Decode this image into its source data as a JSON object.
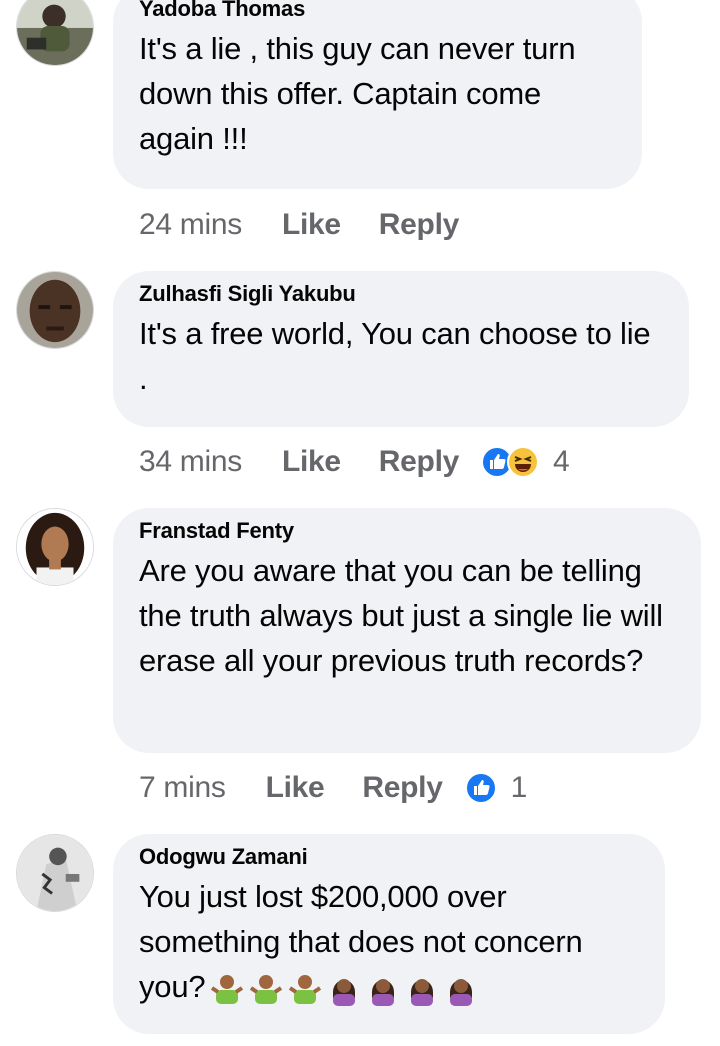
{
  "colors": {
    "bubble_bg": "#f0f2f5",
    "author": "#050505",
    "meta_text": "#65676b",
    "like_blue": "#1877f2"
  },
  "comments": [
    {
      "author": "Yadoba Thomas",
      "text": "It's a lie , this guy can never turn down this offer. Captain come again !!!",
      "time": "24 mins",
      "like_label": "Like",
      "reply_label": "Reply",
      "reactions": [],
      "reaction_count": ""
    },
    {
      "author": "Zulhasfi Sigli Yakubu",
      "text": "It's a free world, You can choose to lie .",
      "time": "34 mins",
      "like_label": "Like",
      "reply_label": "Reply",
      "reactions": [
        "like-icon",
        "haha-icon"
      ],
      "reaction_count": "4"
    },
    {
      "author": "Franstad Fenty",
      "text": "Are you aware that you can be telling the truth always but just a single lie will erase all your previous truth records?",
      "time": "7 mins",
      "like_label": "Like",
      "reply_label": "Reply",
      "reactions": [
        "like-icon"
      ],
      "reaction_count": "1"
    },
    {
      "author": "Odogwu Zamani",
      "text": "You just lost $200,000 over something that does not concern you?",
      "emojis": [
        "shrug-emoji",
        "shrug-emoji",
        "shrug-emoji",
        "facepalm-emoji",
        "facepalm-emoji",
        "facepalm-emoji",
        "facepalm-emoji"
      ]
    }
  ]
}
